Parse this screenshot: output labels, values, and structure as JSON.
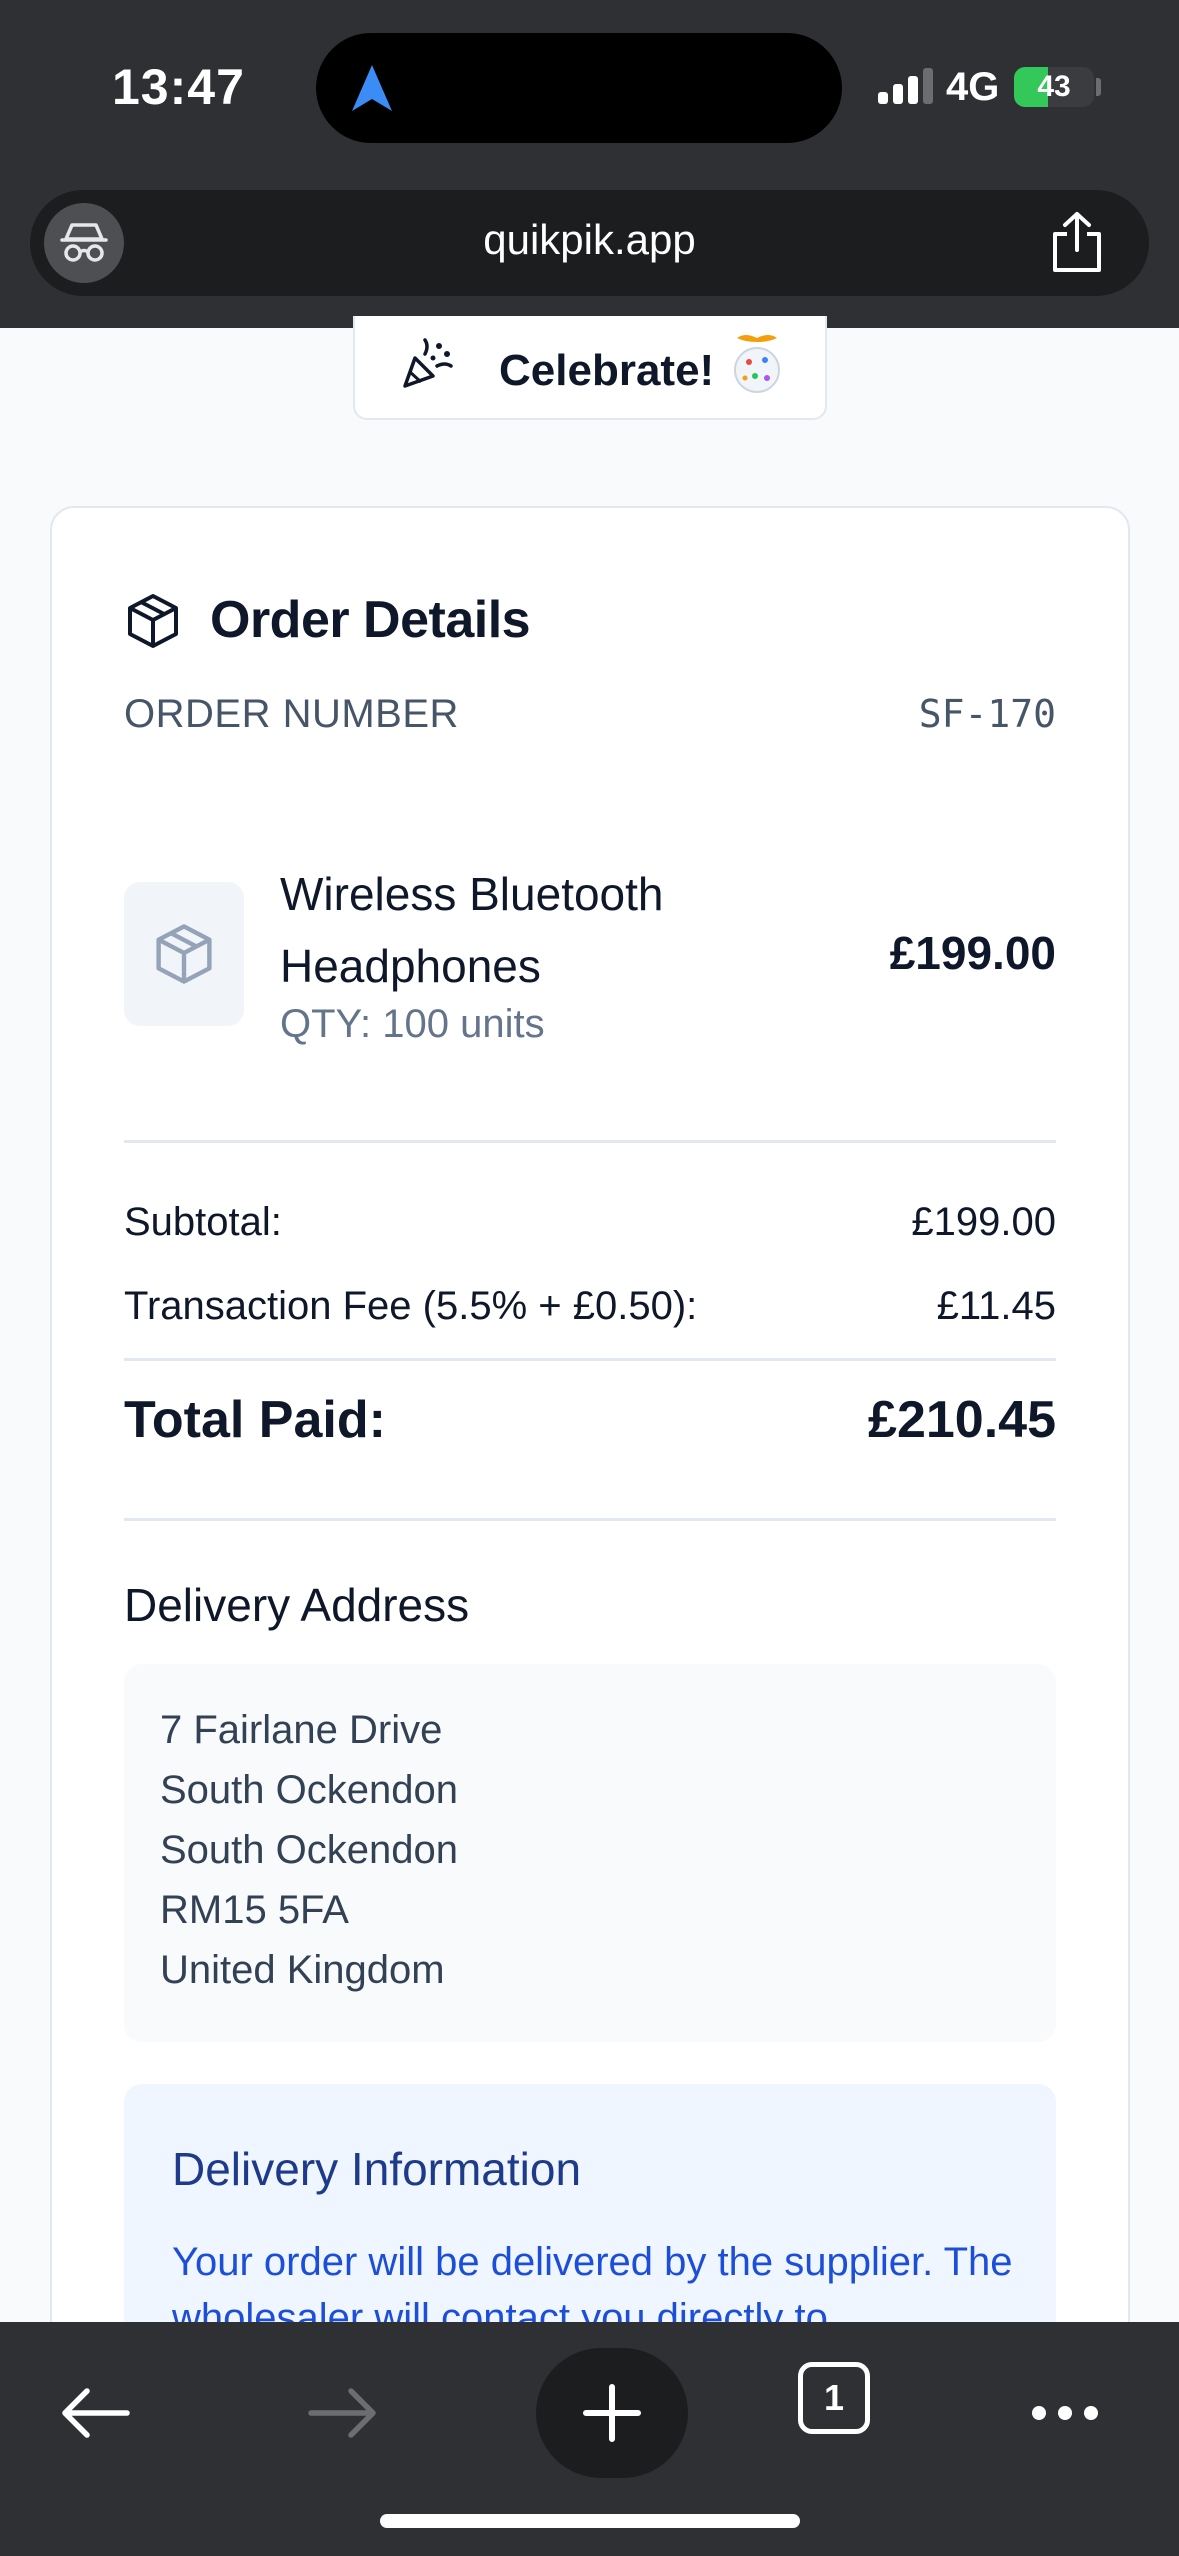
{
  "status_bar": {
    "time": "13:47",
    "network": "4G",
    "battery_level": 43,
    "battery_text": "43",
    "battery_color": "#34c759"
  },
  "browser": {
    "url": "quikpik.app",
    "incognito_icon": "incognito-icon",
    "share_icon": "share-icon",
    "tab_count": "1"
  },
  "celebrate": {
    "label": "Celebrate!",
    "icon": "party-popper-icon",
    "emoji": "confetti-ball-icon"
  },
  "order": {
    "title": "Order Details",
    "title_icon": "package-icon",
    "number_label": "ORDER NUMBER",
    "number_value": "SF-170",
    "item": {
      "name": "Wireless Bluetooth Headphones",
      "qty": "QTY: 100 units",
      "price": "£199.00",
      "thumb_icon": "package-icon"
    },
    "subtotal_label": "Subtotal:",
    "subtotal_value": "£199.00",
    "fee_label": "Transaction Fee (5.5% + £0.50):",
    "fee_value": "£11.45",
    "total_label": "Total Paid:",
    "total_value": "£210.45"
  },
  "delivery_address": {
    "title": "Delivery Address",
    "lines": [
      "7 Fairlane Drive",
      "South Ockendon",
      "South Ockendon",
      "RM15 5FA",
      "United Kingdom"
    ]
  },
  "delivery_info": {
    "title": "Delivery Information",
    "text": "Your order will be delivered by the supplier. The wholesaler will contact you directly to"
  },
  "colors": {
    "chrome": "#2e3033",
    "accent_blue": "#1d4ed8",
    "info_bg": "#eff6ff"
  }
}
